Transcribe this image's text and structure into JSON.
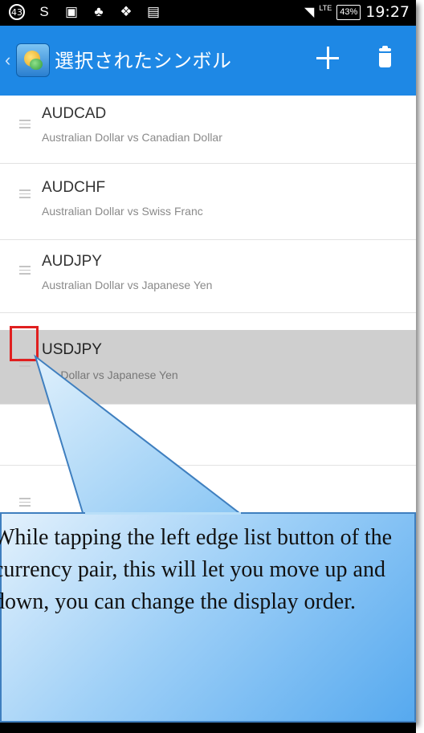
{
  "status_bar": {
    "notif_count": "43",
    "battery": "43%",
    "network": "LTE",
    "time": "19:27",
    "icons": [
      "notification-count-icon",
      "s-app-icon",
      "image-icon",
      "eco-icon",
      "dropbox-icon",
      "clipboard-check-icon",
      "wifi-icon",
      "signal-icon",
      "battery-icon"
    ]
  },
  "action_bar": {
    "title": "選択されたシンボル",
    "color": "#1e88e5",
    "icons": [
      "back-chevron-icon",
      "app-logo-icon",
      "add-icon",
      "trash-icon"
    ]
  },
  "symbols": [
    {
      "symbol": "AUDCAD",
      "description": "Australian Dollar vs Canadian Dollar",
      "selected": false
    },
    {
      "symbol": "AUDCHF",
      "description": "Australian Dollar vs Swiss Franc",
      "selected": false
    },
    {
      "symbol": "AUDJPY",
      "description": "Australian Dollar vs Japanese Yen",
      "selected": false
    },
    {
      "symbol": "USDJPY",
      "description": "US Dollar vs Japanese Yen",
      "selected": true
    }
  ],
  "highlight_color": "#e02020",
  "callout": {
    "text": "While tapping the left edge list button of the currency pair, this will let you move up and down, you can change the display order."
  }
}
